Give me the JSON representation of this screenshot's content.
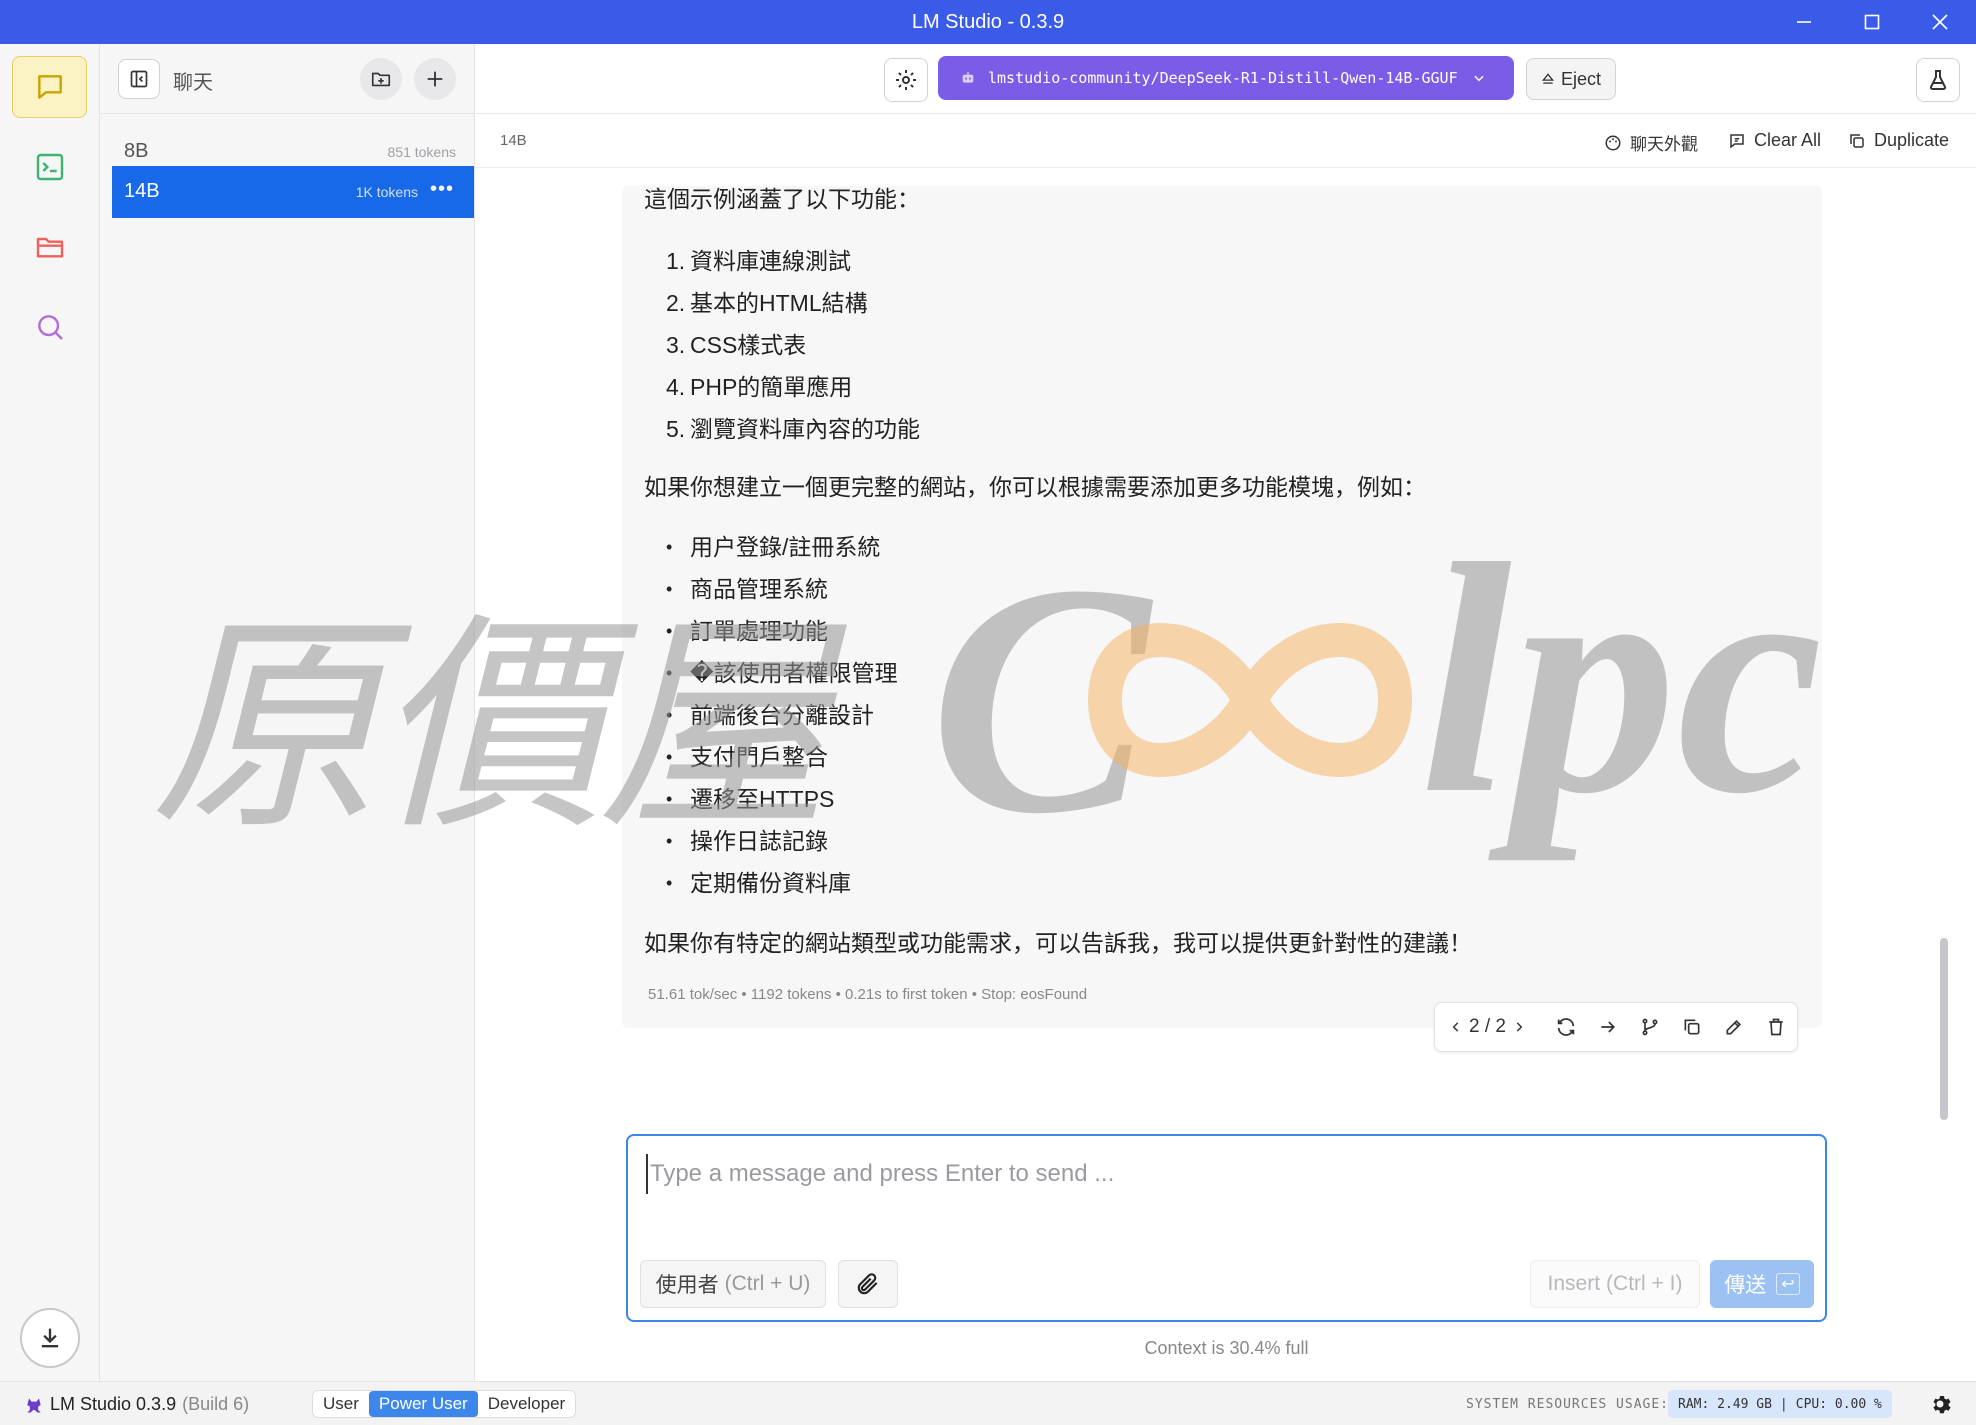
{
  "window": {
    "title": "LM Studio - 0.3.9",
    "minimize": "—",
    "maximize": "☐",
    "close": "✕"
  },
  "rail": {
    "items": [
      {
        "icon": "chat-icon",
        "active": true
      },
      {
        "icon": "terminal-icon",
        "active": false
      },
      {
        "icon": "folder-icon",
        "active": false
      },
      {
        "icon": "search-icon",
        "active": false
      }
    ],
    "download_icon": "download-icon"
  },
  "sidebar": {
    "title": "聊天",
    "chats": [
      {
        "name": "8B",
        "tokens": "851 tokens"
      },
      {
        "name": "14B",
        "tokens": "1K tokens",
        "more": "•••"
      }
    ]
  },
  "toolbar": {
    "model": "lmstudio-community/DeepSeek-R1-Distill-Qwen-14B-GGUF",
    "eject_label": "Eject"
  },
  "subbar": {
    "chat_name": "14B",
    "appearance_label": "聊天外觀",
    "clear_label": "Clear All",
    "duplicate_label": "Duplicate"
  },
  "message": {
    "intro": "這個示例涵蓋了以下功能：",
    "numbered": [
      {
        "n": "1.",
        "text": "資料庫連線測試"
      },
      {
        "n": "2.",
        "text": "基本的HTML結構"
      },
      {
        "n": "3.",
        "text": "CSS樣式表"
      },
      {
        "n": "4.",
        "text": "PHP的簡單應用"
      },
      {
        "n": "5.",
        "text": "瀏覽資料庫內容的功能"
      }
    ],
    "middle": "如果你想建立一個更完整的網站，你可以根據需要添加更多功能模塊，例如：",
    "bullets": [
      "用户登錄/註冊系統",
      "商品管理系統",
      "訂單處理功能",
      "�該使用者權限管理",
      "前端後台分離設計",
      "支付門戶整合",
      "遷移至HTTPS",
      "操作日誌記錄",
      "定期備份資料庫"
    ],
    "outro": "如果你有特定的網站類型或功能需求，可以告訴我，我可以提供更針對性的建議！",
    "stats": "51.61 tok/sec  •  1192 tokens  •  0.21s to first token  •  Stop: eosFound",
    "pager": "2 / 2"
  },
  "watermark": {
    "chinese": "原價屋",
    "latin_c": "C",
    "latin_lpc": "lpc"
  },
  "composer": {
    "placeholder": "Type a message and press Enter to send ...",
    "role_label": "使用者",
    "role_shortcut": "(Ctrl + U)",
    "insert_label": "Insert",
    "insert_shortcut": "(Ctrl + I)",
    "send_label": "傳送",
    "send_key": "↩",
    "context": "Context is 30.4% full"
  },
  "status": {
    "app_name": "LM Studio 0.3.9",
    "build": "(Build 6)",
    "modes": [
      "User",
      "Power User",
      "Developer"
    ],
    "active_mode": "Power User",
    "resources_label": "SYSTEM RESOURCES USAGE:",
    "ram": "RAM: 2.49 GB",
    "sep": "|",
    "cpu": "CPU: 0.00 %"
  },
  "colors": {
    "titlebar": "#3a5be8",
    "accent": "#1869e8",
    "model_button": "#7b5ce6",
    "active_rail": "#fcf3c5"
  }
}
